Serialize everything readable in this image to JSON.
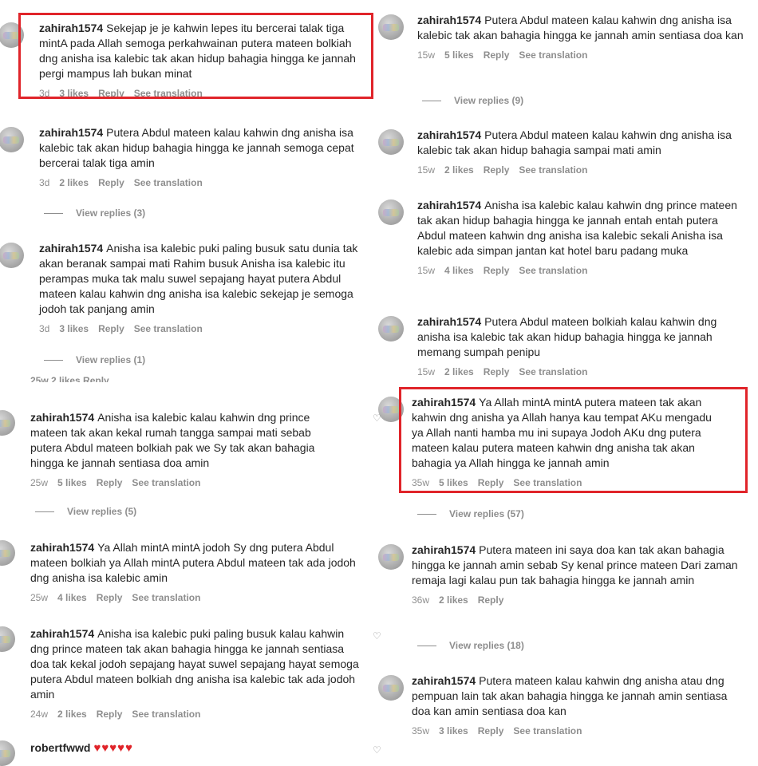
{
  "left": [
    {
      "user": "zahirah1574",
      "text": "Sekejap je je kahwin lepes itu bercerai talak tiga mintA pada Allah semoga perkahwainan putera mateen bolkiah dng anisha isa kalebic tak akan hidup bahagia hingga ke jannah pergi mampus lah bukan minat",
      "time": "3d",
      "likes": "3 likes",
      "reply": "Reply",
      "translate": "See translation"
    },
    {
      "user": "zahirah1574",
      "text": "Putera Abdul mateen kalau kahwin dng anisha isa kalebic tak akan hidup bahagia hingga ke jannah semoga cepat bercerai talak tiga amin",
      "time": "3d",
      "likes": "2 likes",
      "reply": "Reply",
      "translate": "See translation",
      "replies": "View replies (3)"
    },
    {
      "user": "zahirah1574",
      "text": "Anisha isa kalebic puki paling busuk satu dunia tak akan beranak sampai mati Rahim busuk Anisha isa kalebic itu perampas muka tak malu suwel sepajang hayat putera Abdul mateen kalau kahwin dng anisha isa kalebic sekejap je semoga jodoh tak panjang amin",
      "time": "3d",
      "likes": "3 likes",
      "reply": "Reply",
      "translate": "See translation",
      "replies": "View replies (1)"
    },
    {
      "cutoff": "25w  2 likes  Reply"
    },
    {
      "user": "zahirah1574",
      "text": "Anisha isa kalebic kalau kahwin dng prince mateen tak akan kekal rumah tangga sampai mati sebab putera Abdul mateen bolkiah pak we Sy tak akan bahagia hingga ke jannah sentiasa doa amin",
      "time": "25w",
      "likes": "5 likes",
      "reply": "Reply",
      "translate": "See translation",
      "replies": "View replies (5)"
    },
    {
      "user": "zahirah1574",
      "text": "Ya Allah mintA mintA jodoh Sy dng putera Abdul mateen bolkiah ya Allah mintA putera Abdul mateen tak ada jodoh dng anisha isa kalebic amin",
      "time": "25w",
      "likes": "4 likes",
      "reply": "Reply",
      "translate": "See translation"
    },
    {
      "user": "zahirah1574",
      "text": "Anisha isa kalebic puki paling busuk kalau kahwin dng prince mateen tak akan bahagia hingga ke jannah sentiasa doa tak kekal jodoh sepajang hayat suwel sepajang hayat semoga putera Abdul mateen bolkiah dng anisha isa kalebic tak ada jodoh amin",
      "time": "24w",
      "likes": "2 likes",
      "reply": "Reply",
      "translate": "See translation"
    },
    {
      "user": "robertfwwd",
      "text": "♥♥♥♥♥"
    }
  ],
  "right": [
    {
      "user": "zahirah1574",
      "text": "Putera Abdul mateen kalau kahwin dng anisha isa kalebic tak akan bahagia hingga ke jannah amin sentiasa doa kan",
      "time": "15w",
      "likes": "5 likes",
      "reply": "Reply",
      "translate": "See translation",
      "replies": "View replies (9)"
    },
    {
      "user": "zahirah1574",
      "text": "Putera Abdul mateen kalau kahwin dng anisha isa kalebic tak akan hidup bahagia sampai mati amin",
      "time": "15w",
      "likes": "2 likes",
      "reply": "Reply",
      "translate": "See translation"
    },
    {
      "user": "zahirah1574",
      "text": "Anisha isa kalebic kalau kahwin dng prince mateen tak akan hidup bahagia hingga ke jannah entah entah putera Abdul mateen kahwin dng anisha isa kalebic sekali Anisha isa kalebic ada simpan jantan kat hotel baru padang muka",
      "time": "15w",
      "likes": "4 likes",
      "reply": "Reply",
      "translate": "See translation"
    },
    {
      "user": "zahirah1574",
      "text": "Putera Abdul mateen bolkiah kalau kahwin dng anisha isa kalebic tak akan hidup bahagia hingga ke jannah memang sumpah penipu",
      "time": "15w",
      "likes": "2 likes",
      "reply": "Reply",
      "translate": "See translation"
    },
    {
      "user": "zahirah1574",
      "text": "Ya Allah mintA mintA putera mateen tak akan kahwin dng anisha ya Allah hanya kau tempat AKu mengadu ya Allah nanti hamba mu ini supaya Jodoh AKu dng putera mateen kalau putera mateen kahwin dng anisha tak akan bahagia ya Allah hingga ke jannah amin",
      "time": "35w",
      "likes": "5 likes",
      "reply": "Reply",
      "translate": "See translation",
      "replies": "View replies (57)"
    },
    {
      "user": "zahirah1574",
      "text": "Putera mateen ini saya doa kan tak akan bahagia hingga ke jannah amin sebab Sy kenal prince mateen Dari zaman remaja lagi kalau pun tak bahagia hingga ke jannah amin",
      "time": "36w",
      "likes": "2 likes",
      "reply": "Reply",
      "replies": "View replies (18)"
    },
    {
      "user": "zahirah1574",
      "text": "Putera mateen kalau kahwin dng anisha atau dng pempuan lain tak akan bahagia hingga ke jannah amin sentiasa doa kan amin sentiasa doa kan",
      "time": "35w",
      "likes": "3 likes",
      "reply": "Reply",
      "translate": "See translation"
    }
  ],
  "colors": {
    "highlight": "#e0242a",
    "muted": "#8e8e8e",
    "text": "#262626"
  }
}
